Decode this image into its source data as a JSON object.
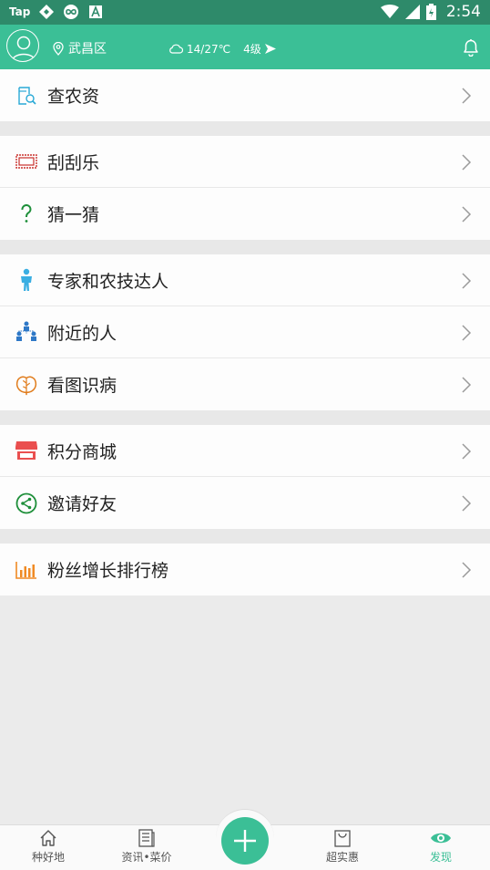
{
  "status_bar": {
    "left_label": "Tap",
    "time": "2:54",
    "icons": [
      "tap-icon",
      "diamond-app-icon",
      "infinity-app-icon",
      "a-app-icon",
      "wifi-icon",
      "signal-icon",
      "battery-icon"
    ]
  },
  "header": {
    "location": "武昌区",
    "temperature": "14/27℃",
    "wind": "4级",
    "colors": {
      "brand": "#3bbf96",
      "status_bar": "#2e8a6a"
    }
  },
  "menu": {
    "groups": [
      {
        "items": [
          {
            "label": "查农资",
            "icon": "search-doc-icon"
          }
        ]
      },
      {
        "items": [
          {
            "label": "刮刮乐",
            "icon": "ticket-icon"
          },
          {
            "label": "猜一猜",
            "icon": "question-icon"
          }
        ]
      },
      {
        "items": [
          {
            "label": "专家和农技达人",
            "icon": "expert-icon"
          },
          {
            "label": "附近的人",
            "icon": "nearby-people-icon"
          },
          {
            "label": "看图识病",
            "icon": "plant-disease-icon"
          }
        ]
      },
      {
        "items": [
          {
            "label": "积分商城",
            "icon": "shop-icon"
          },
          {
            "label": "邀请好友",
            "icon": "share-icon"
          }
        ]
      },
      {
        "items": [
          {
            "label": "粉丝增长排行榜",
            "icon": "bar-chart-icon"
          }
        ]
      }
    ]
  },
  "bottom_nav": {
    "tabs": [
      {
        "label": "种好地",
        "icon": "home-icon",
        "active": false
      },
      {
        "label": "资讯•菜价",
        "icon": "news-icon",
        "active": false
      },
      {
        "label": "超实惠",
        "icon": "bag-icon",
        "active": false
      },
      {
        "label": "发现",
        "icon": "eye-icon",
        "active": true
      }
    ],
    "fab_icon": "plus-icon"
  }
}
